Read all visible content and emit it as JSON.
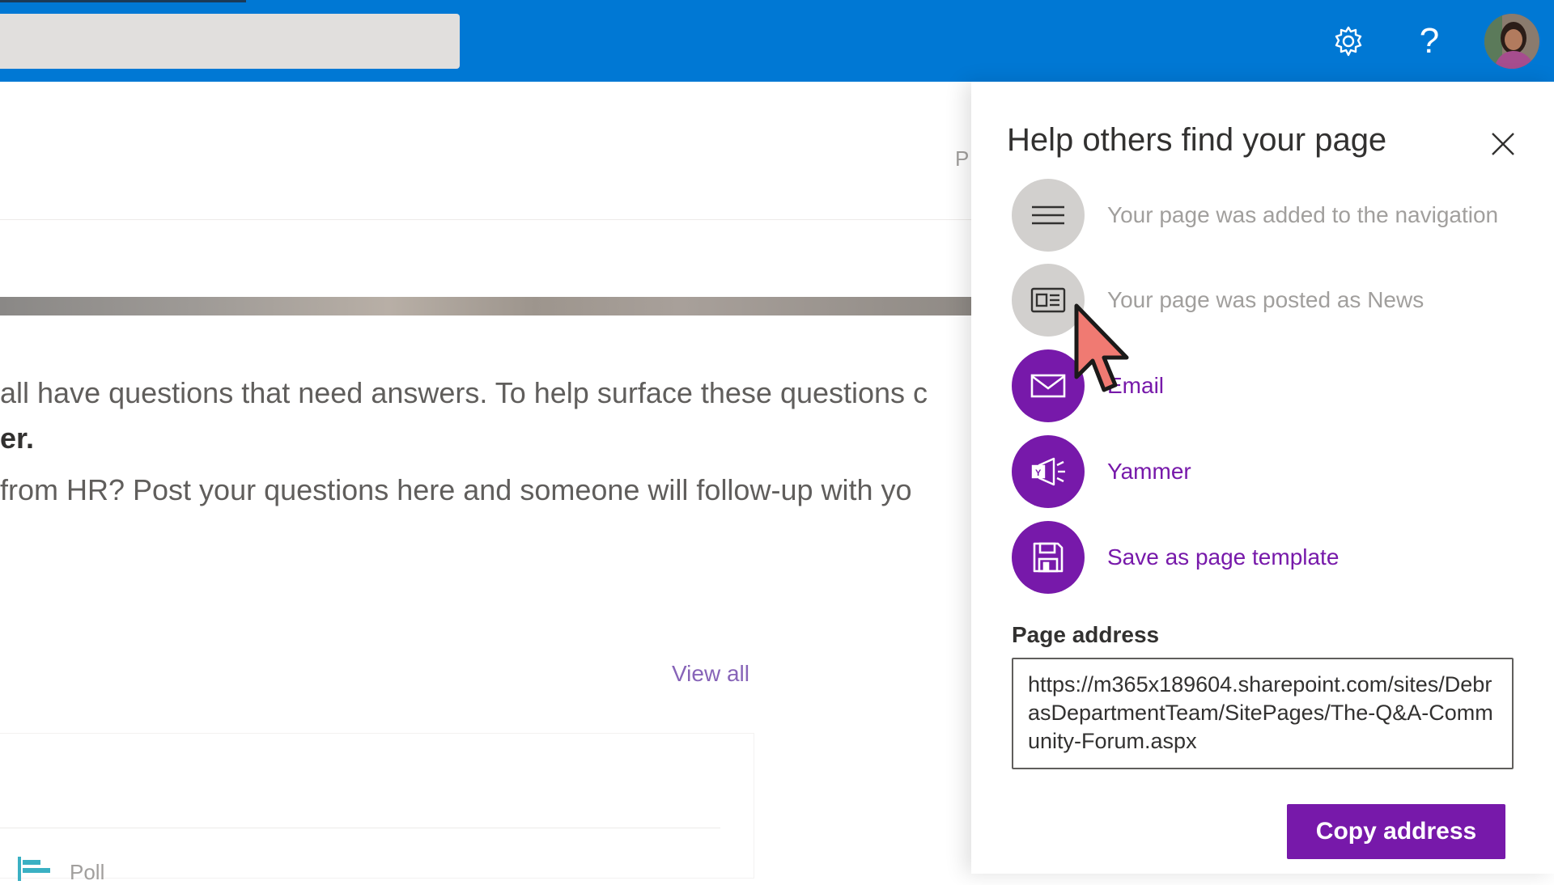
{
  "suite_bar": {
    "help_glyph": "?",
    "icons": {
      "settings": "gear-icon",
      "help": "question-icon",
      "avatar": "user-avatar"
    },
    "color": "#0078d4"
  },
  "page": {
    "header_letter": "P",
    "paragraph_1": "all have questions that need answers.  To help surface these questions c",
    "paragraph_1_tail": "er.",
    "paragraph_2": "from HR?  Post your questions here and someone will follow-up with yo",
    "view_all": "View all",
    "poll_label": "Poll"
  },
  "panel": {
    "title": "Help others find your page",
    "actions": [
      {
        "icon": "navigation-icon",
        "label": "Your page was added to the navigation",
        "enabled": false
      },
      {
        "icon": "news-icon",
        "label": "Your page was posted as News",
        "enabled": false
      },
      {
        "icon": "email-icon",
        "label": "Email",
        "enabled": true
      },
      {
        "icon": "yammer-icon",
        "label": "Yammer",
        "enabled": true
      },
      {
        "icon": "save-icon",
        "label": "Save as page template",
        "enabled": true
      }
    ],
    "page_address_label": "Page address",
    "page_address": "https://m365x189604.sharepoint.com/sites/DebrasDepartmentTeam/SitePages/The-Q&A-Community-Forum.aspx",
    "copy_button": "Copy address",
    "accent_color": "#7719aa"
  }
}
